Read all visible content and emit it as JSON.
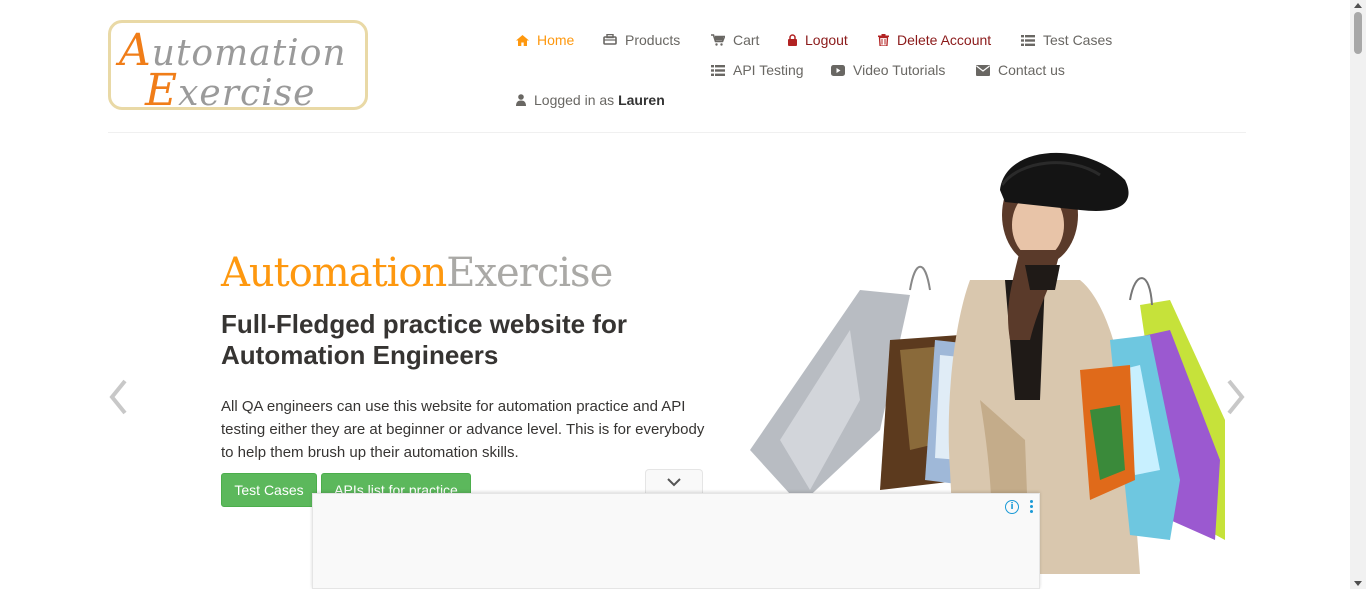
{
  "brand": {
    "line1_cap": "A",
    "line1_rest": "utomation",
    "line2_cap": "E",
    "line2_rest": "xercise"
  },
  "nav": {
    "home": "Home",
    "products": "Products",
    "cart": "Cart",
    "logout": "Logout",
    "delete_account": "Delete Account",
    "test_cases": "Test Cases",
    "api_testing": "API Testing",
    "video_tutorials": "Video Tutorials",
    "contact_us": "Contact us",
    "logged_in_prefix": "Logged in as",
    "username": "Lauren"
  },
  "hero": {
    "title_part1": "Automation",
    "title_part2": "Exercise",
    "heading": "Full-Fledged practice website for Automation Engineers",
    "paragraph": "All QA engineers can use this website for automation practice and API testing either they are at beginner or advance level. This is for everybody to help them brush up their automation skills.",
    "btn_test_cases": "Test Cases",
    "btn_apis": "APIs list for practice"
  },
  "icons": {
    "home": "home-icon",
    "products": "products-icon",
    "cart": "cart-icon",
    "logout": "lock-icon",
    "delete": "trash-icon",
    "test_cases": "list-icon",
    "api": "list-icon",
    "video": "youtube-icon",
    "contact": "envelope-icon",
    "user": "user-icon"
  },
  "colors": {
    "accent": "#FE980F",
    "button": "#5cb85c",
    "danger": "#8b1a1a",
    "text": "#696763"
  }
}
